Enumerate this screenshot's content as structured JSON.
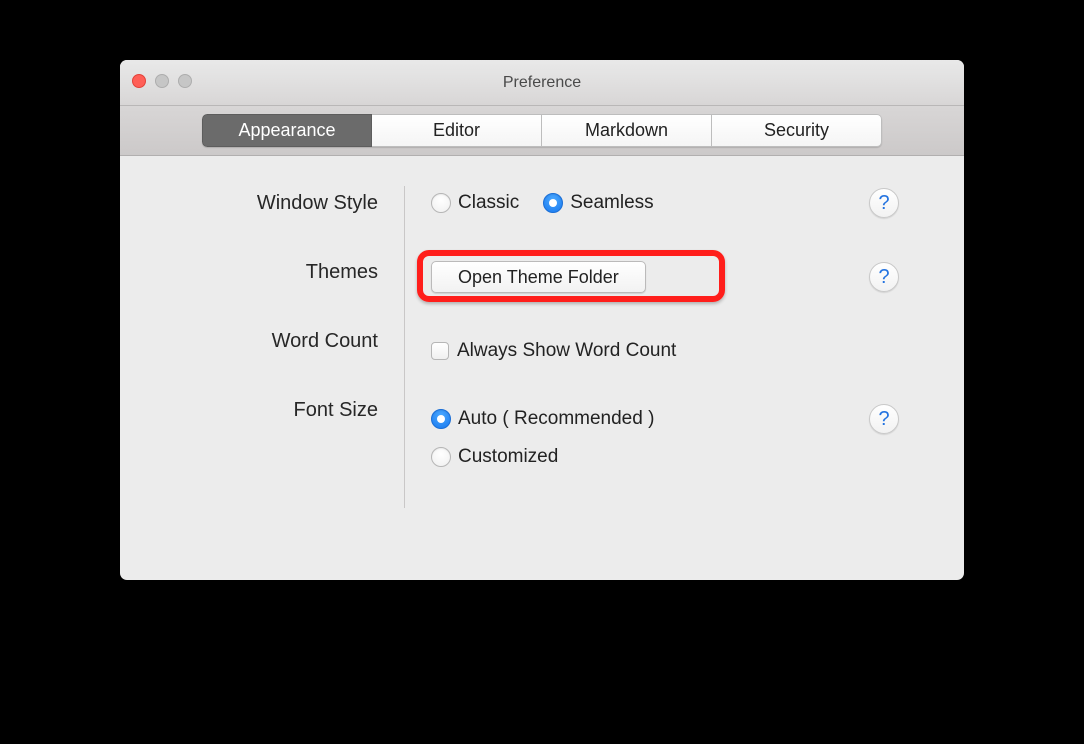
{
  "window": {
    "title": "Preference"
  },
  "tabs": [
    {
      "label": "Appearance",
      "active": true
    },
    {
      "label": "Editor",
      "active": false
    },
    {
      "label": "Markdown",
      "active": false
    },
    {
      "label": "Security",
      "active": false
    }
  ],
  "appearance": {
    "window_style": {
      "label": "Window Style",
      "options": [
        {
          "label": "Classic",
          "checked": false
        },
        {
          "label": "Seamless",
          "checked": true
        }
      ]
    },
    "themes": {
      "label": "Themes",
      "button": "Open Theme Folder"
    },
    "word_count": {
      "label": "Word Count",
      "checkbox_label": "Always Show Word Count",
      "checked": false
    },
    "font_size": {
      "label": "Font Size",
      "options": [
        {
          "label": "Auto ( Recommended )",
          "checked": true
        },
        {
          "label": "Customized",
          "checked": false
        }
      ]
    }
  },
  "help_glyph": "?"
}
